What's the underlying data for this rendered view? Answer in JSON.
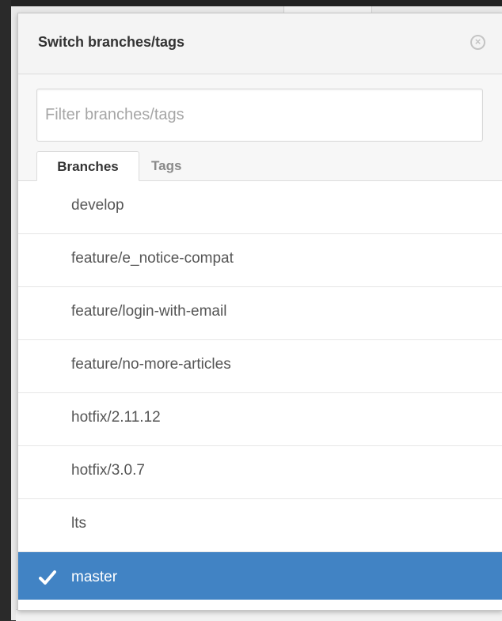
{
  "dialog": {
    "title": "Switch branches/tags",
    "close_icon": "close-circle-icon"
  },
  "filter": {
    "placeholder": "Filter branches/tags",
    "value": ""
  },
  "tabs": [
    {
      "label": "Branches",
      "active": true
    },
    {
      "label": "Tags",
      "active": false
    }
  ],
  "branches": [
    {
      "label": "develop",
      "selected": false
    },
    {
      "label": "feature/e_notice-compat",
      "selected": false
    },
    {
      "label": "feature/login-with-email",
      "selected": false
    },
    {
      "label": "feature/no-more-articles",
      "selected": false
    },
    {
      "label": "hotfix/2.11.12",
      "selected": false
    },
    {
      "label": "hotfix/3.0.7",
      "selected": false
    },
    {
      "label": "lts",
      "selected": false
    },
    {
      "label": "master",
      "selected": true
    }
  ],
  "selected_icon": "check-icon",
  "colors": {
    "selected_bg": "#4183c4",
    "selected_text": "#ffffff",
    "item_text": "#555555"
  }
}
